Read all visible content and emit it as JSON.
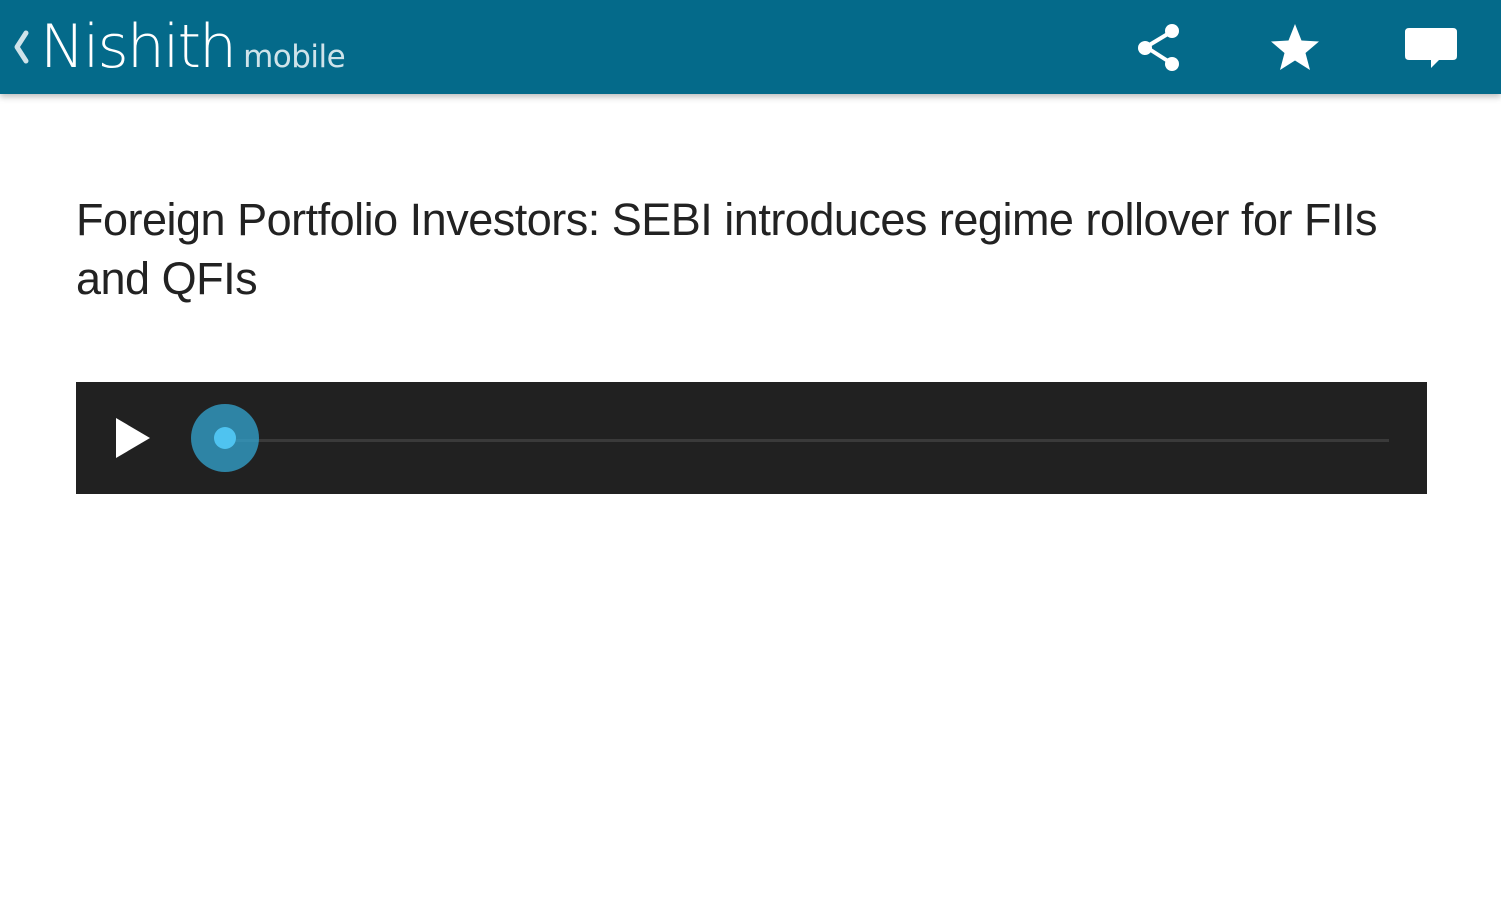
{
  "app_bar": {
    "back_icon": "chevron-left-icon",
    "brand_name": "Nishith",
    "brand_sub": "mobile",
    "background_color": "#046a8a",
    "actions": [
      {
        "icon": "share-icon"
      },
      {
        "icon": "star-icon"
      },
      {
        "icon": "comment-icon"
      }
    ]
  },
  "article": {
    "title": "Foreign Portfolio Investors: SEBI introduces regime rollover for FIIs and QFIs"
  },
  "audio_player": {
    "play_icon": "play-icon",
    "progress": 0,
    "background_color": "#212121",
    "accent_color": "#33a6d2"
  }
}
